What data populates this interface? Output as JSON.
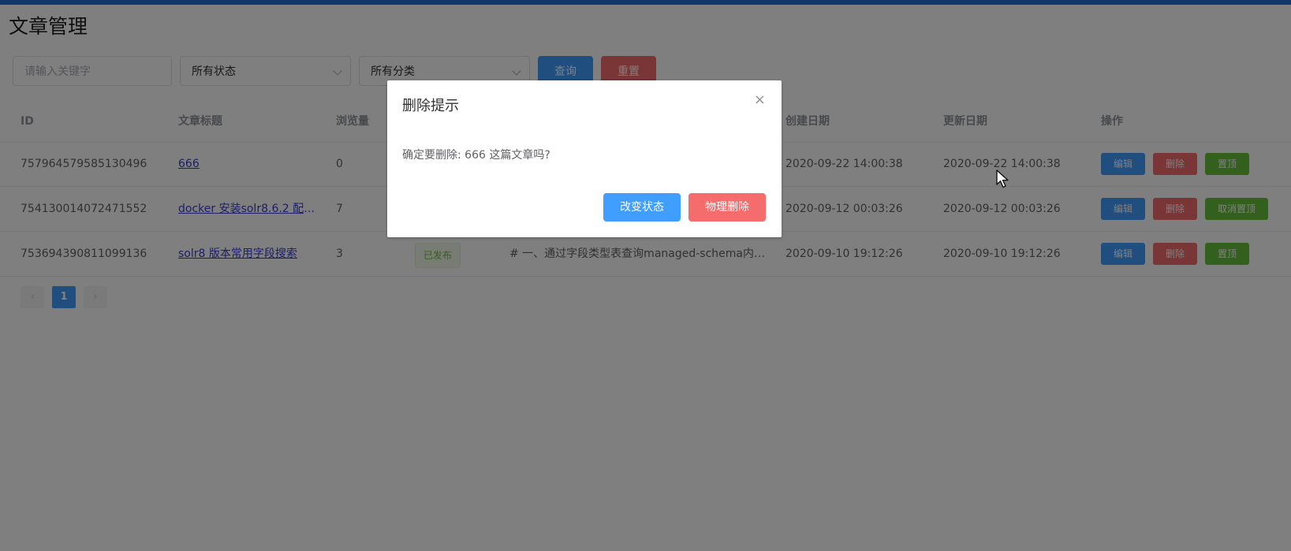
{
  "page": {
    "title": "文章管理"
  },
  "filters": {
    "keyword_placeholder": "请输入关键字",
    "status_value": "所有状态",
    "category_value": "所有分类",
    "query_label": "查询",
    "reset_label": "重置"
  },
  "table": {
    "headers": {
      "id": "ID",
      "title": "文章标题",
      "views": "浏览量",
      "created": "创建日期",
      "updated": "更新日期",
      "actions": "操作"
    },
    "rows": [
      {
        "id": "757964579585130496",
        "title": "666",
        "views": "0",
        "status": "",
        "summary": "",
        "created": "2020-09-22 14:00:38",
        "updated": "2020-09-22 14:00:38",
        "edit": "编辑",
        "delete": "删除",
        "top": "置顶"
      },
      {
        "id": "754130014072471552",
        "title": "docker 安装solr8.6.2 配置...",
        "views": "7",
        "status": "",
        "summary": "",
        "created": "2020-09-12 00:03:26",
        "updated": "2020-09-12 00:03:26",
        "edit": "编辑",
        "delete": "删除",
        "top": "取消置顶"
      },
      {
        "id": "753694390811099136",
        "title": "solr8 版本常用字段搜索",
        "views": "3",
        "status": "已发布",
        "summary": "# 一、通过字段类型表查询managed-schema内字...",
        "created": "2020-09-10 19:12:26",
        "updated": "2020-09-10 19:12:26",
        "edit": "编辑",
        "delete": "删除",
        "top": "置顶"
      }
    ]
  },
  "pagination": {
    "current": "1",
    "prev": "‹",
    "next": "›"
  },
  "dialog": {
    "title": "删除提示",
    "close": "×",
    "message": "确定要删除: 666 这篇文章吗?",
    "change_status_label": "改变状态",
    "physical_delete_label": "物理删除"
  },
  "colors": {
    "primary": "#409eff",
    "danger": "#f56c6c",
    "success": "#67c23a",
    "topbar": "#1f6fd8"
  }
}
